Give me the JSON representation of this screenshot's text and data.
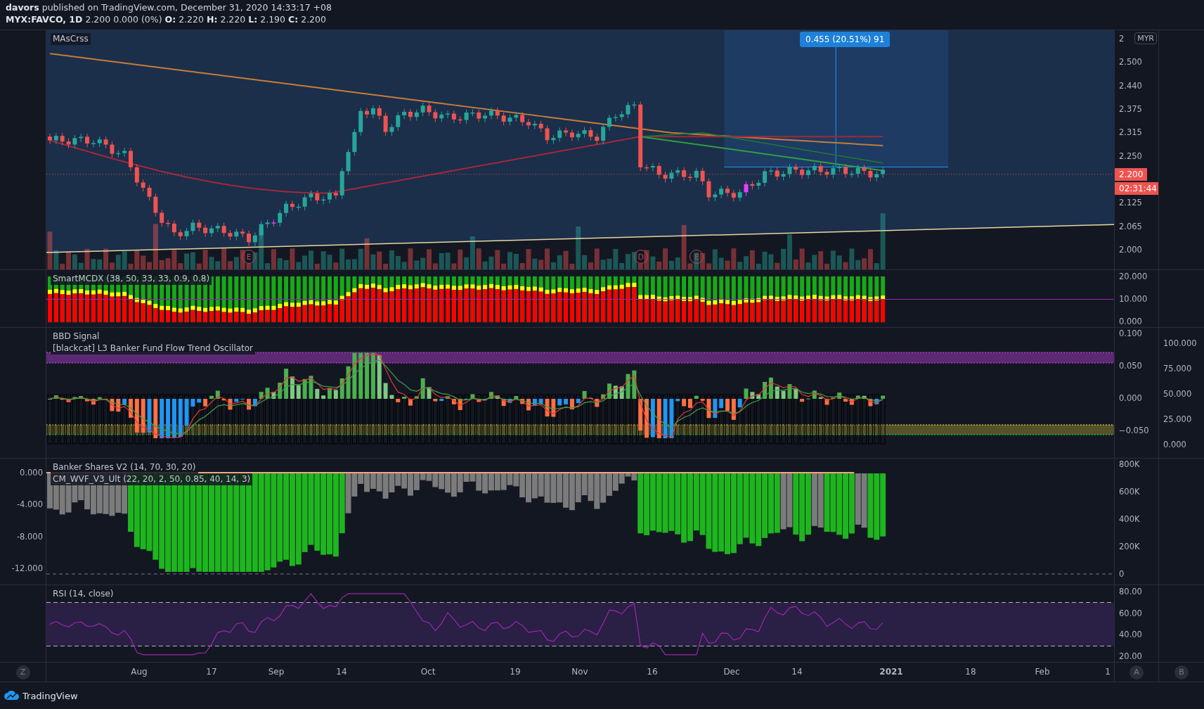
{
  "header": {
    "author": "davors",
    "published": "published on TradingView.com, December 31, 2020 14:33:17 +08",
    "symbol": "MYX:FAVCO, 1D",
    "quote": "2.200 0.000 (0%)",
    "ohlc": [
      {
        "label": "O:",
        "value": "2.220"
      },
      {
        "label": "H:",
        "value": "2.220"
      },
      {
        "label": "L:",
        "value": "2.190"
      },
      {
        "label": "C:",
        "value": "2.200"
      }
    ]
  },
  "panes": [
    {
      "kind": "price",
      "legends": [
        "MAsCrss"
      ],
      "right_scale": [
        "2",
        "2.500",
        "2.440",
        "2.375",
        "2.315",
        "2.250",
        "2.125",
        "2.065",
        "2.000"
      ]
    },
    {
      "kind": "mcdx",
      "legends": [
        "SmartMCDX (38, 50, 33, 33, 0.9, 0.8)"
      ],
      "right_scale": [
        "20.000",
        "10.000",
        "0.000"
      ]
    },
    {
      "kind": "bbd",
      "legends": [
        "BBD Signal",
        "[blackcat] L3 Banker Fund Flow Trend Oscillator"
      ],
      "right_scale": [
        "0.100",
        "0.050",
        "0.000",
        "−0.050"
      ],
      "second_scale": [
        "100.000",
        "75.000",
        "50.000",
        "25.000",
        "0.000"
      ]
    },
    {
      "kind": "banker",
      "legends": [
        "Banker Shares V2 (14, 70, 30, 20)",
        "CM_WVF_V3_Ult (22, 20, 2, 50, 0.85, 40, 14, 3)"
      ],
      "left_scale": [
        "0.000",
        "-4.000",
        "-8.000",
        "-12.000"
      ],
      "right_scale": [
        "800K",
        "600K",
        "400K",
        "200K",
        "0"
      ]
    },
    {
      "kind": "rsi",
      "legends": [
        "RSI (14, close)"
      ],
      "right_scale": [
        "80.00",
        "60.00",
        "40.00",
        "20.00"
      ]
    }
  ],
  "main": {
    "currency": "MYR",
    "last_price": "2.200",
    "countdown": "02:31:44",
    "measure_label": "0.455 (20.51%) 91",
    "events": [
      "E",
      "D",
      "E"
    ]
  },
  "time_axis": {
    "left_button": "Z",
    "right_buttons": [
      "A",
      "B"
    ],
    "labels": [
      {
        "text": "Aug",
        "bold": false
      },
      {
        "text": "17",
        "bold": false
      },
      {
        "text": "Sep",
        "bold": false
      },
      {
        "text": "14",
        "bold": false
      },
      {
        "text": "Oct",
        "bold": false
      },
      {
        "text": "19",
        "bold": false
      },
      {
        "text": "Nov",
        "bold": false
      },
      {
        "text": "16",
        "bold": false
      },
      {
        "text": "Dec",
        "bold": false
      },
      {
        "text": "14",
        "bold": false
      },
      {
        "text": "2021",
        "bold": true
      },
      {
        "text": "18",
        "bold": false
      },
      {
        "text": "Feb",
        "bold": false
      },
      {
        "text": "1",
        "bold": false
      }
    ]
  },
  "footer": {
    "brand": "TradingView"
  }
}
